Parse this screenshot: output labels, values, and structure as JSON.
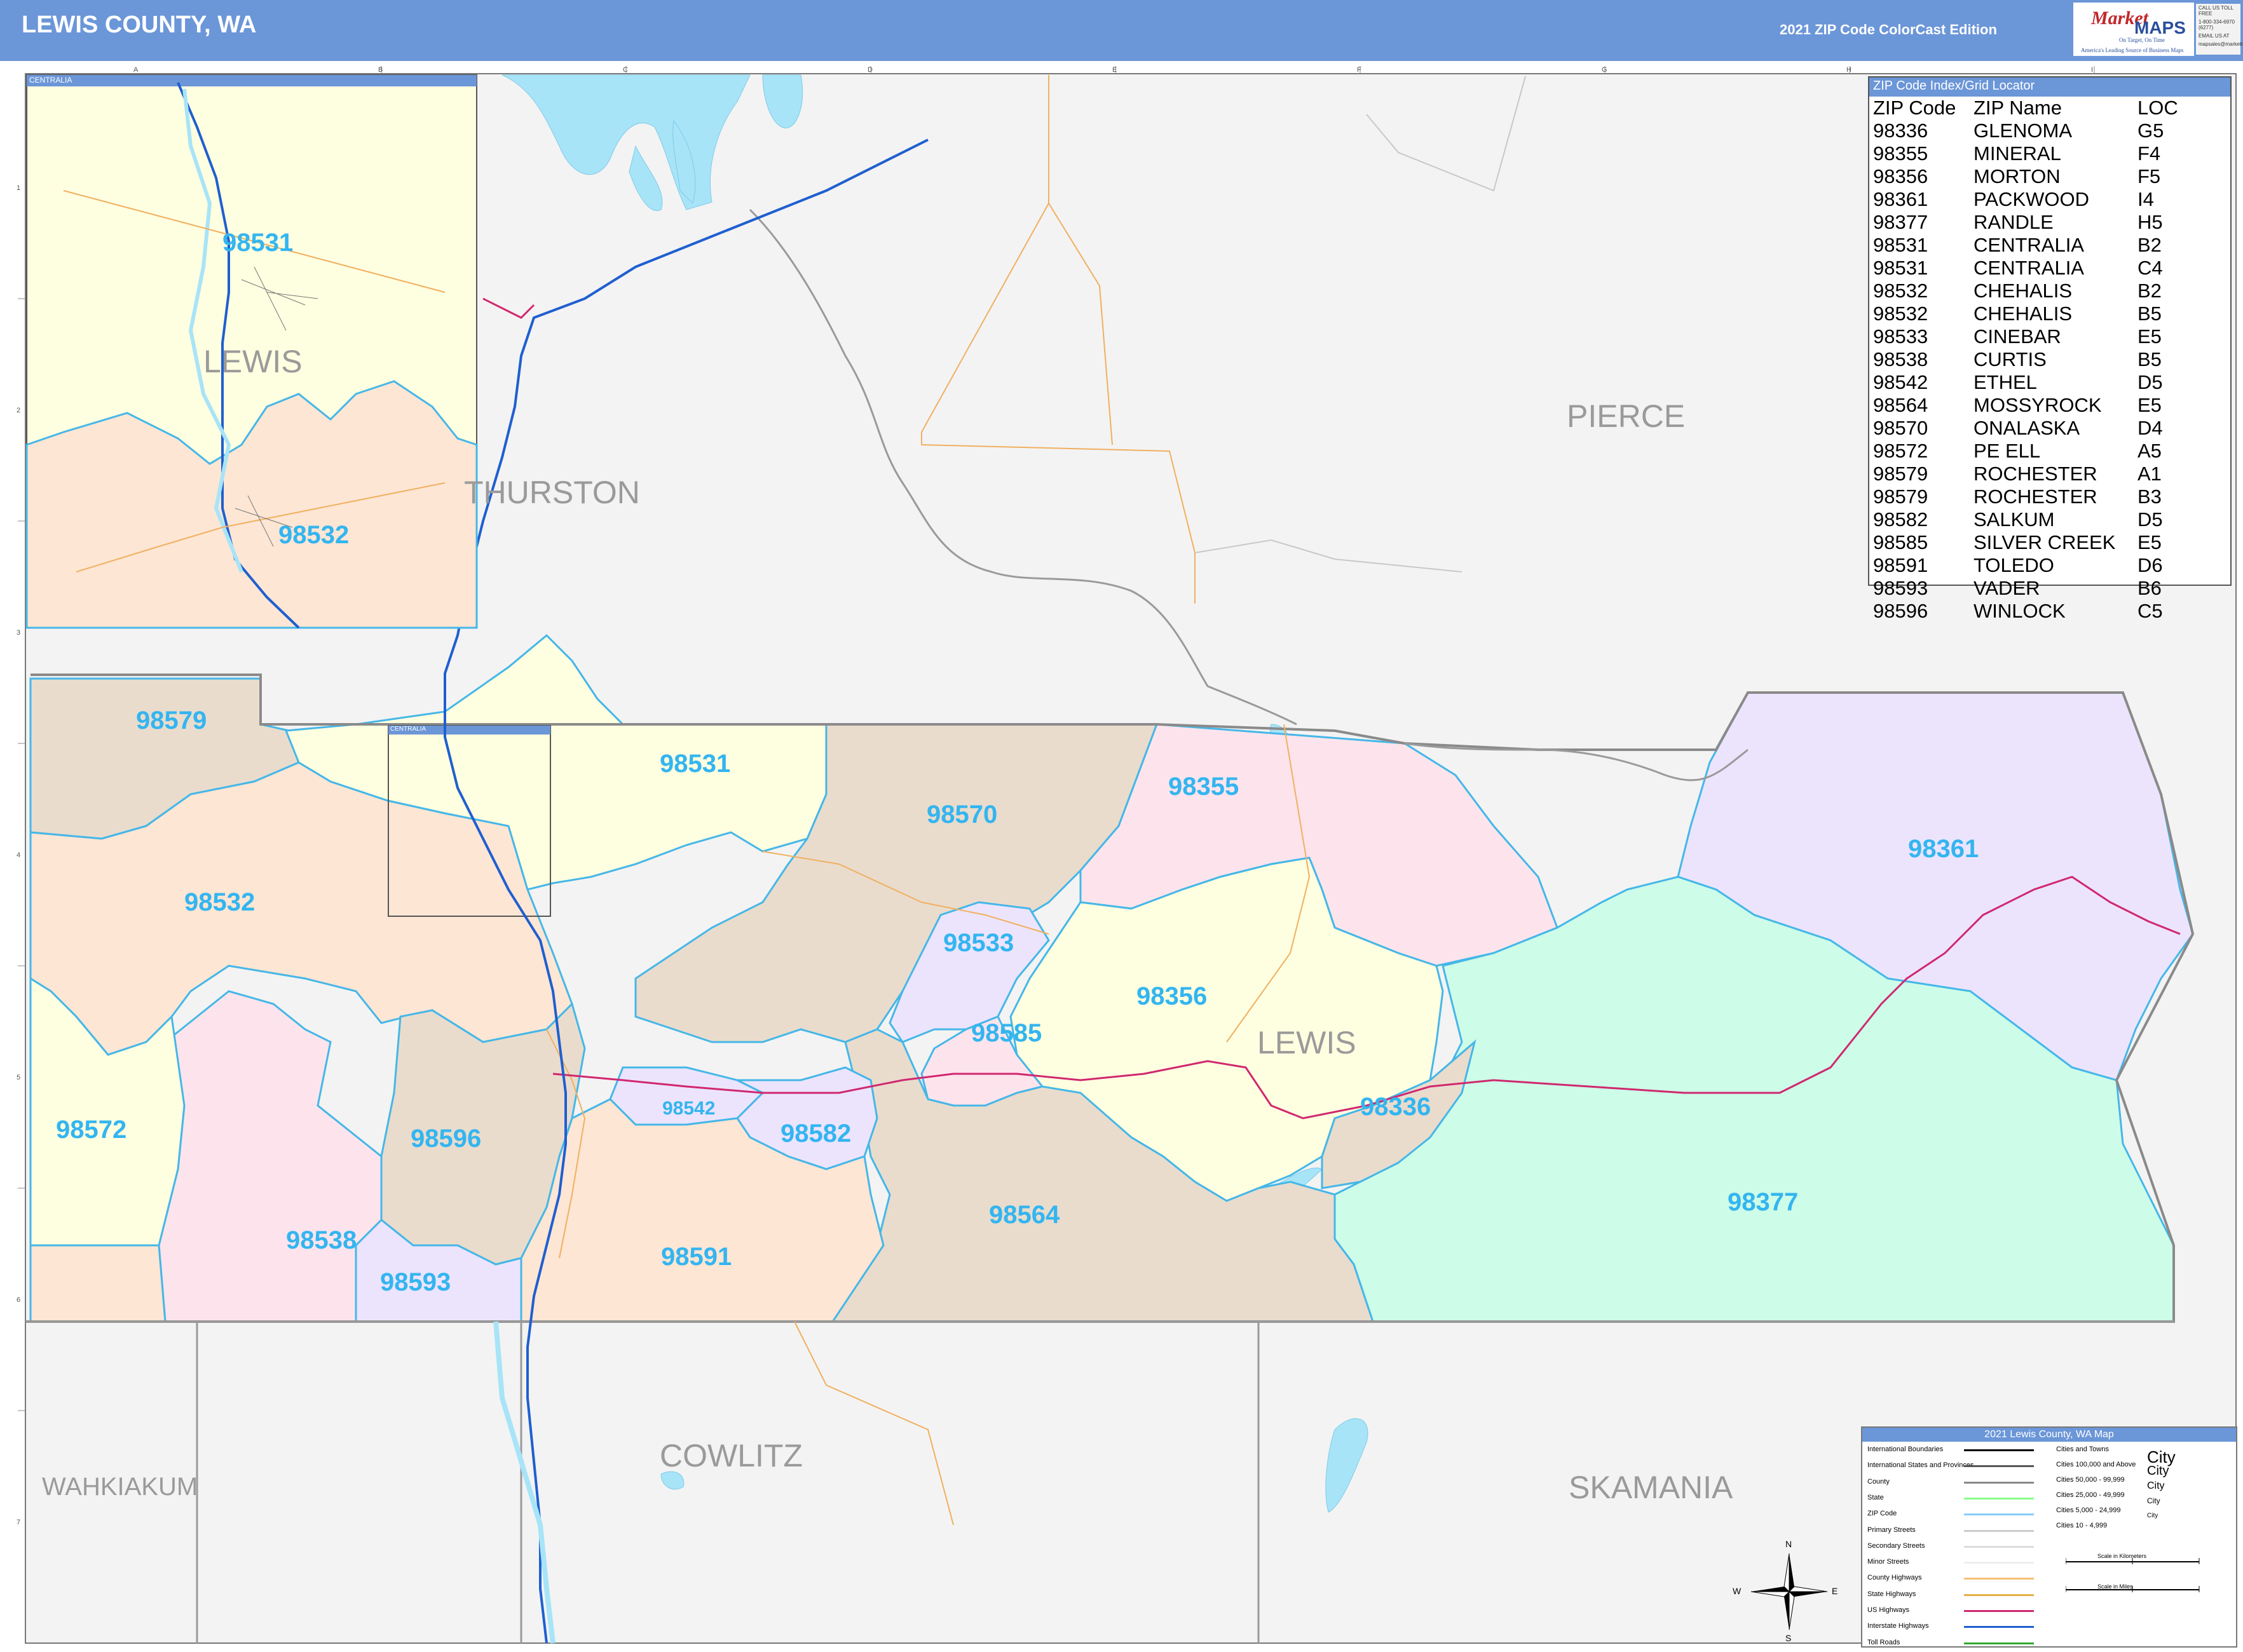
{
  "header": {
    "title": "LEWIS COUNTY, WA",
    "edition": "2021 ZIP Code ColorCast Edition",
    "logo_market": "Market",
    "logo_maps": "MAPS",
    "logo_tagline": "On Target, On Time",
    "logo_sub": "America's Leading Source of Business Maps",
    "contact": [
      "CALL US TOLL FREE",
      "1-800-334-6970 (6277)",
      "EMAIL US AT",
      "mapsales@marketmaps.com"
    ]
  },
  "map": {
    "grid_columns": [
      "A",
      "B",
      "C",
      "D",
      "E",
      "F",
      "G",
      "H",
      "I"
    ],
    "grid_rows": [
      "1",
      "2",
      "3",
      "4",
      "5",
      "6",
      "7"
    ],
    "inset_label": "CENTRALIA",
    "counties": [
      "THURSTON",
      "PIERCE",
      "LEWIS",
      "COWLITZ",
      "WAHKIAKUM",
      "SKAMANIA"
    ],
    "inset_counties": [
      "LEWIS"
    ],
    "zip_labels": [
      "98579",
      "98531",
      "98570",
      "98355",
      "98361",
      "98532",
      "98533",
      "98356",
      "98585",
      "98572",
      "98596",
      "98542",
      "98582",
      "98336",
      "98377",
      "98564",
      "98538",
      "98591",
      "98593"
    ],
    "inset_zip_labels": [
      "98531",
      "98532"
    ],
    "colors": {
      "water": "#a8e4f8",
      "out_of_county": "#f3f3f3",
      "yellow_zone": "#fefee0",
      "orange_zone": "#fde6d4",
      "tan_zone": "#e9dccd",
      "pink_zone": "#fde4ec",
      "purple_zone": "#ece4fd",
      "green_zone": "#cdfce8",
      "zip_label": "#33b5f0",
      "interstate": "#1f5fd0",
      "us_highway": "#d0286f"
    }
  },
  "zip_index": {
    "title": "ZIP Code Index/Grid Locator",
    "columns": [
      "ZIP Code",
      "ZIP Name",
      "LOC"
    ],
    "rows": [
      [
        "98336",
        "GLENOMA",
        "G5"
      ],
      [
        "98355",
        "MINERAL",
        "F4"
      ],
      [
        "98356",
        "MORTON",
        "F5"
      ],
      [
        "98361",
        "PACKWOOD",
        "I4"
      ],
      [
        "98377",
        "RANDLE",
        "H5"
      ],
      [
        "98531",
        "CENTRALIA",
        "B2"
      ],
      [
        "98531",
        "CENTRALIA",
        "C4"
      ],
      [
        "98532",
        "CHEHALIS",
        "B2"
      ],
      [
        "98532",
        "CHEHALIS",
        "B5"
      ],
      [
        "98533",
        "CINEBAR",
        "E5"
      ],
      [
        "98538",
        "CURTIS",
        "B5"
      ],
      [
        "98542",
        "ETHEL",
        "D5"
      ],
      [
        "98564",
        "MOSSYROCK",
        "E5"
      ],
      [
        "98570",
        "ONALASKA",
        "D4"
      ],
      [
        "98572",
        "PE ELL",
        "A5"
      ],
      [
        "98579",
        "ROCHESTER",
        "A1"
      ],
      [
        "98579",
        "ROCHESTER",
        "B3"
      ],
      [
        "98582",
        "SALKUM",
        "D5"
      ],
      [
        "98585",
        "SILVER CREEK",
        "E5"
      ],
      [
        "98591",
        "TOLEDO",
        "D6"
      ],
      [
        "98593",
        "VADER",
        "B6"
      ],
      [
        "98596",
        "WINLOCK",
        "C5"
      ]
    ]
  },
  "legend": {
    "title": "2021 Lewis County, WA Map",
    "line_items": [
      "International Boundaries",
      "International States and Provinces",
      "County",
      "State",
      "ZIP Code",
      "Primary Streets",
      "Secondary Streets",
      "Minor Streets",
      "County Highways",
      "State Highways",
      "US Highways",
      "Interstate Highways",
      "Toll Roads"
    ],
    "city_items": [
      "Cities and Towns",
      "Cities 100,000 and Above",
      "Cities 50,000 - 99,999",
      "Cities 25,000 - 49,999",
      "Cities 5,000 - 24,999",
      "Cities 10 - 4,999"
    ],
    "city_samples": [
      "City",
      "City",
      "City",
      "City",
      "City"
    ],
    "scale_km": "Scale in Kilometers",
    "scale_miles": "Scale in Miles"
  },
  "compass": {
    "n": "N",
    "s": "S",
    "e": "E",
    "w": "W"
  }
}
